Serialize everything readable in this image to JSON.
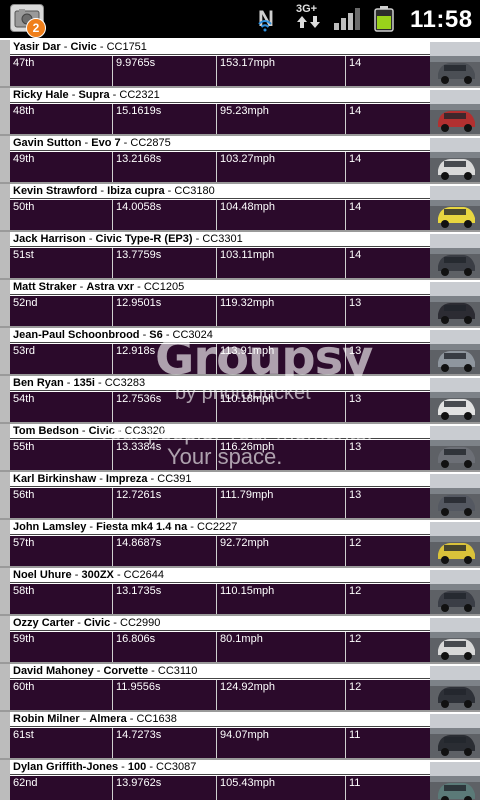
{
  "status_bar": {
    "notification_count": "2",
    "network_type": "3G+",
    "n_label": "N",
    "clock": "11:58"
  },
  "entries": [
    {
      "driver": "Yasir Dar",
      "car": "Civic",
      "code": "CC1751",
      "position": "47th",
      "time": "9.9765s",
      "speed": "153.17mph",
      "laps": "14",
      "thumb_color": "#4b4f55"
    },
    {
      "driver": "Ricky Hale",
      "car": "Supra",
      "code": "CC2321",
      "position": "48th",
      "time": "15.1619s",
      "speed": "95.23mph",
      "laps": "14",
      "thumb_color": "#b23030"
    },
    {
      "driver": "Gavin Sutton",
      "car": "Evo 7",
      "code": "CC2875",
      "position": "49th",
      "time": "13.2168s",
      "speed": "103.27mph",
      "laps": "14",
      "thumb_color": "#d9d9d9"
    },
    {
      "driver": "Kevin Strawford",
      "car": "Ibiza cupra",
      "code": "CC3180",
      "position": "50th",
      "time": "14.0058s",
      "speed": "104.48mph",
      "laps": "14",
      "thumb_color": "#e8d640"
    },
    {
      "driver": "Jack Harrison",
      "car": "Civic Type-R (EP3)",
      "code": "CC3301",
      "position": "51st",
      "time": "13.7759s",
      "speed": "103.11mph",
      "laps": "14",
      "thumb_color": "#3a3d44"
    },
    {
      "driver": "Matt Straker",
      "car": "Astra vxr",
      "code": "CC1205",
      "position": "52nd",
      "time": "12.9501s",
      "speed": "119.32mph",
      "laps": "13",
      "thumb_color": "#2c2c33"
    },
    {
      "driver": "Jean-Paul Schoonbrood",
      "car": "S6",
      "code": "CC3024",
      "position": "53rd",
      "time": "12.918s",
      "speed": "113.91mph",
      "laps": "13",
      "thumb_color": "#8f969e"
    },
    {
      "driver": "Ben Ryan",
      "car": "135i",
      "code": "CC3283",
      "position": "54th",
      "time": "12.7536s",
      "speed": "110.18mph",
      "laps": "13",
      "thumb_color": "#e2e2e2"
    },
    {
      "driver": "Tom Bedson",
      "car": "Civic",
      "code": "CC3320",
      "position": "55th",
      "time": "13.3384s",
      "speed": "116.26mph",
      "laps": "13",
      "thumb_color": "#6c6f76"
    },
    {
      "driver": "Karl Birkinshaw",
      "car": "Impreza",
      "code": "CC391",
      "position": "56th",
      "time": "12.7261s",
      "speed": "111.79mph",
      "laps": "13",
      "thumb_color": "#545861"
    },
    {
      "driver": "John Lamsley",
      "car": "Fiesta mk4 1.4 na",
      "code": "CC2227",
      "position": "57th",
      "time": "14.8687s",
      "speed": "92.72mph",
      "laps": "12",
      "thumb_color": "#d9c23a"
    },
    {
      "driver": "Noel Uhure",
      "car": "300ZX",
      "code": "CC2644",
      "position": "58th",
      "time": "13.1735s",
      "speed": "110.15mph",
      "laps": "12",
      "thumb_color": "#3b3e46"
    },
    {
      "driver": "Ozzy Carter",
      "car": "Civic",
      "code": "CC2990",
      "position": "59th",
      "time": "16.806s",
      "speed": "80.1mph",
      "laps": "12",
      "thumb_color": "#d8d8d8"
    },
    {
      "driver": "David Mahoney",
      "car": "Corvette",
      "code": "CC3110",
      "position": "60th",
      "time": "11.9556s",
      "speed": "124.92mph",
      "laps": "12",
      "thumb_color": "#2e3138"
    },
    {
      "driver": "Robin Milner",
      "car": "Almera",
      "code": "CC1638",
      "position": "61st",
      "time": "14.7273s",
      "speed": "94.07mph",
      "laps": "11",
      "thumb_color": "#2a2d33"
    },
    {
      "driver": "Dylan Griffith-Jones",
      "car": "100",
      "code": "CC3087",
      "position": "62nd",
      "time": "13.9762s",
      "speed": "105.43mph",
      "laps": "11",
      "thumb_color": "#5b7a78"
    }
  ],
  "watermark": {
    "logo": "Groupsy",
    "byline": "by photobucket",
    "tagline_1": "Your people. Your moments.",
    "tagline_2": "Your space."
  },
  "colors": {
    "row_background": "#2b0a2b",
    "status_bar": "#000000",
    "badge": "#f07f1a"
  }
}
